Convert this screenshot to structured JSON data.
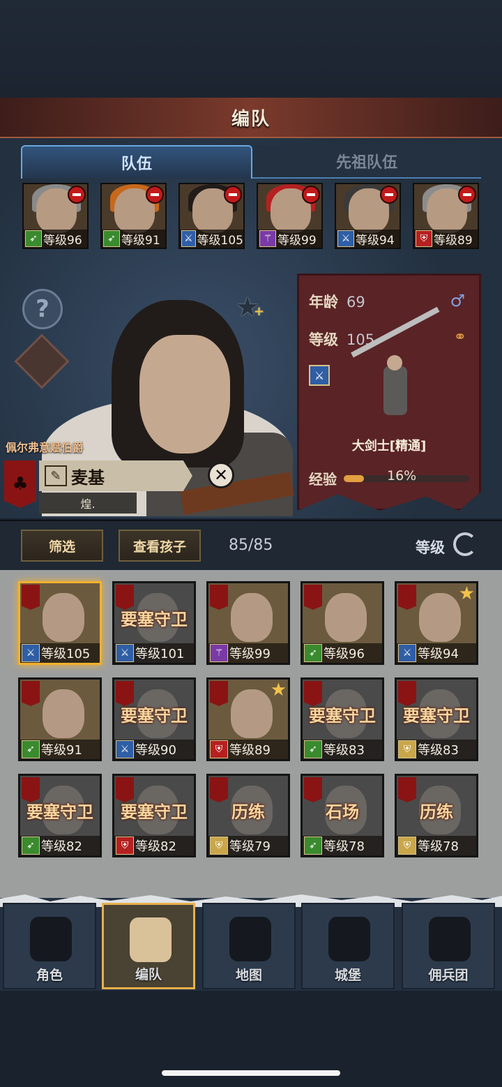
{
  "header": {
    "title": "编队"
  },
  "tabs": [
    {
      "label": "队伍",
      "active": true
    },
    {
      "label": "先祖队伍",
      "active": false
    }
  ],
  "team": [
    {
      "level": "等级96",
      "class_icon": "bow-icon",
      "class_color": "#3a8a2e",
      "hair": "#8a8a8a"
    },
    {
      "level": "等级91",
      "class_icon": "bow-icon",
      "class_color": "#3a8a2e",
      "hair": "#c8681a"
    },
    {
      "level": "等级105",
      "class_icon": "sword-icon",
      "class_color": "#2f5ea6",
      "hair": "#211c19"
    },
    {
      "level": "等级99",
      "class_icon": "staff-icon",
      "class_color": "#7a3aa6",
      "hair": "#b52020"
    },
    {
      "level": "等级94",
      "class_icon": "sword-icon",
      "class_color": "#2f5ea6",
      "hair": "#3a3a3a"
    },
    {
      "level": "等级89",
      "class_icon": "shield-icon",
      "class_color": "#b52020",
      "hair": "#8c8c8c"
    }
  ],
  "hero": {
    "house": "佩尔弗意赋伯爵",
    "name": "麦基",
    "sub": "煌.",
    "age_label": "年龄",
    "age": "69",
    "level_label": "等级",
    "level": "105",
    "class_name": "大剑士[精通]",
    "exp_label": "经验",
    "exp_percent": "16%",
    "exp_fraction": 0.16
  },
  "controls": {
    "filter": "筛选",
    "view_children": "查看孩子",
    "count": "85/85",
    "sort": "等级"
  },
  "roster": [
    {
      "tag": "",
      "level": "等级105",
      "class_color": "#2f5ea6",
      "class_icon": "sword-icon",
      "selected": true,
      "dim": false,
      "star": false
    },
    {
      "tag": "要塞守卫",
      "level": "等级101",
      "class_color": "#2f5ea6",
      "class_icon": "sword-icon",
      "selected": false,
      "dim": true,
      "star": false
    },
    {
      "tag": "",
      "level": "等级99",
      "class_color": "#7a3aa6",
      "class_icon": "staff-icon",
      "selected": false,
      "dim": false,
      "star": false
    },
    {
      "tag": "",
      "level": "等级96",
      "class_color": "#3a8a2e",
      "class_icon": "bow-icon",
      "selected": false,
      "dim": false,
      "star": false
    },
    {
      "tag": "",
      "level": "等级94",
      "class_color": "#2f5ea6",
      "class_icon": "sword-icon",
      "selected": false,
      "dim": false,
      "star": true
    },
    {
      "tag": "",
      "level": "等级91",
      "class_color": "#3a8a2e",
      "class_icon": "bow-icon",
      "selected": false,
      "dim": false,
      "star": false
    },
    {
      "tag": "要塞守卫",
      "level": "等级90",
      "class_color": "#2f5ea6",
      "class_icon": "sword-icon",
      "selected": false,
      "dim": true,
      "star": false
    },
    {
      "tag": "",
      "level": "等级89",
      "class_color": "#b52020",
      "class_icon": "shield-icon",
      "selected": false,
      "dim": false,
      "star": true
    },
    {
      "tag": "要塞守卫",
      "level": "等级83",
      "class_color": "#3a8a2e",
      "class_icon": "bow-icon",
      "selected": false,
      "dim": true,
      "star": false
    },
    {
      "tag": "要塞守卫",
      "level": "等级83",
      "class_color": "#c9a64a",
      "class_icon": "shield-icon",
      "selected": false,
      "dim": true,
      "star": false
    },
    {
      "tag": "要塞守卫",
      "level": "等级82",
      "class_color": "#3a8a2e",
      "class_icon": "bow-icon",
      "selected": false,
      "dim": true,
      "star": false
    },
    {
      "tag": "要塞守卫",
      "level": "等级82",
      "class_color": "#b52020",
      "class_icon": "shield-icon",
      "selected": false,
      "dim": true,
      "star": false
    },
    {
      "tag": "历练",
      "level": "等级79",
      "class_color": "#c9a64a",
      "class_icon": "shield-icon",
      "selected": false,
      "dim": true,
      "star": false
    },
    {
      "tag": "石场",
      "level": "等级78",
      "class_color": "#3a8a2e",
      "class_icon": "bow-icon",
      "selected": false,
      "dim": true,
      "star": false
    },
    {
      "tag": "历练",
      "level": "等级78",
      "class_color": "#c9a64a",
      "class_icon": "shield-icon",
      "selected": false,
      "dim": true,
      "star": false
    }
  ],
  "nav": [
    {
      "label": "角色",
      "icon": "knight-icon",
      "active": false
    },
    {
      "label": "编队",
      "icon": "helmet-icon",
      "active": true
    },
    {
      "label": "地图",
      "icon": "compass-map-icon",
      "active": false
    },
    {
      "label": "城堡",
      "icon": "castle-icon",
      "active": false
    },
    {
      "label": "佣兵团",
      "icon": "mercenary-icon",
      "active": false
    }
  ]
}
